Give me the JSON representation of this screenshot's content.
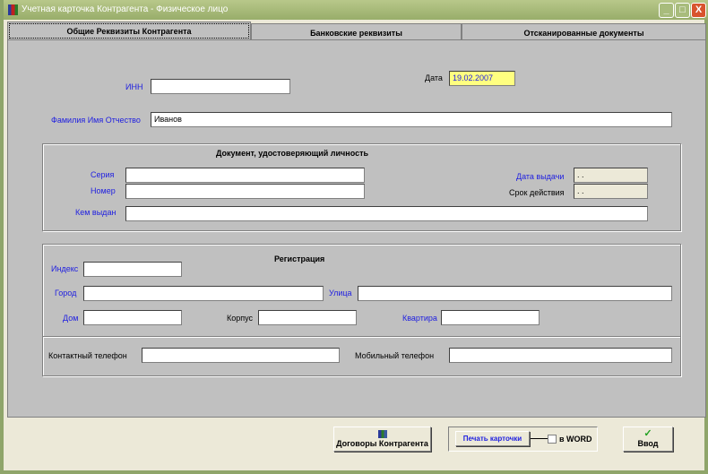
{
  "window": {
    "title": "Учетная карточка Контрагента - Физическое лицо",
    "min": "_",
    "max": "□",
    "close": "X"
  },
  "tabs": [
    {
      "label": "Общие Реквизиты Контрагента"
    },
    {
      "label": "Банковские реквизиты"
    },
    {
      "label": "Отсканированные документы"
    }
  ],
  "main": {
    "inn_label": "ИНН",
    "inn_value": "",
    "date_label": "Дата",
    "date_value": "19.02.2007",
    "fio_label": "Фамилия Имя Отчество",
    "fio_value": "Иванов"
  },
  "doc": {
    "title": "Документ, удостоверяющий личность",
    "series_label": "Серия",
    "series_value": "",
    "number_label": "Номер",
    "number_value": "",
    "issued_by_label": "Кем выдан",
    "issued_by_value": "",
    "issue_date_label": "Дата выдачи",
    "issue_date_value": " . .",
    "validity_label": "Срок действия",
    "validity_value": " . ."
  },
  "reg": {
    "title": "Регистрация",
    "index_label": "Индекс",
    "city_label": "Город",
    "street_label": "Улица",
    "house_label": "Дом",
    "building_label": "Корпус",
    "apt_label": "Квартира",
    "phone_label": "Контактный телефон",
    "mobile_label": "Мобильный телефон"
  },
  "buttons": {
    "contracts": "Договоры Контрагента",
    "print": "Печать карточки",
    "word": "в WORD",
    "enter": "Ввод",
    "check": "✓"
  },
  "colors": {
    "date_bg": "#ffff80",
    "label_blue": "#2020e0"
  }
}
